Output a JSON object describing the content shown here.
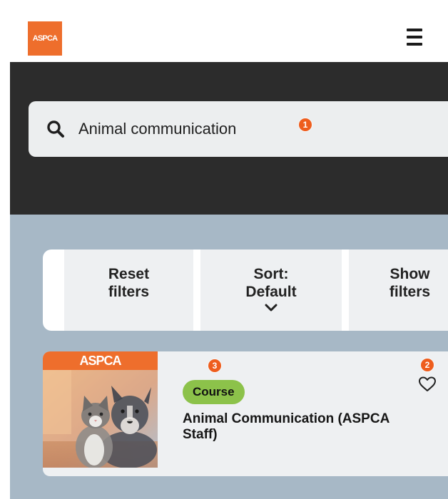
{
  "header": {
    "logo_text": "ASPCA",
    "menu_icon": "hamburger-menu-icon"
  },
  "search": {
    "value": "Animal communication",
    "icon": "search-icon"
  },
  "markers": {
    "search": "1",
    "favorite": "2",
    "course": "3"
  },
  "filters": {
    "reset_line1": "Reset",
    "reset_line2": "filters",
    "sort_line1": "Sort:",
    "sort_line2": "Default",
    "show_line1": "Show",
    "show_line2": "filters"
  },
  "results": [
    {
      "thumbnail_banner": "ASPCA",
      "badge": "Course",
      "title": "Animal Communication (ASPCA Staff)",
      "favorite_icon": "heart-outline-icon"
    }
  ],
  "colors": {
    "brand_orange": "#ee6e2c",
    "search_band": "#2c2c2c",
    "results_bg": "#a7b8c6",
    "badge_green": "#8cc24a",
    "marker_orange": "#ee5d1d"
  }
}
